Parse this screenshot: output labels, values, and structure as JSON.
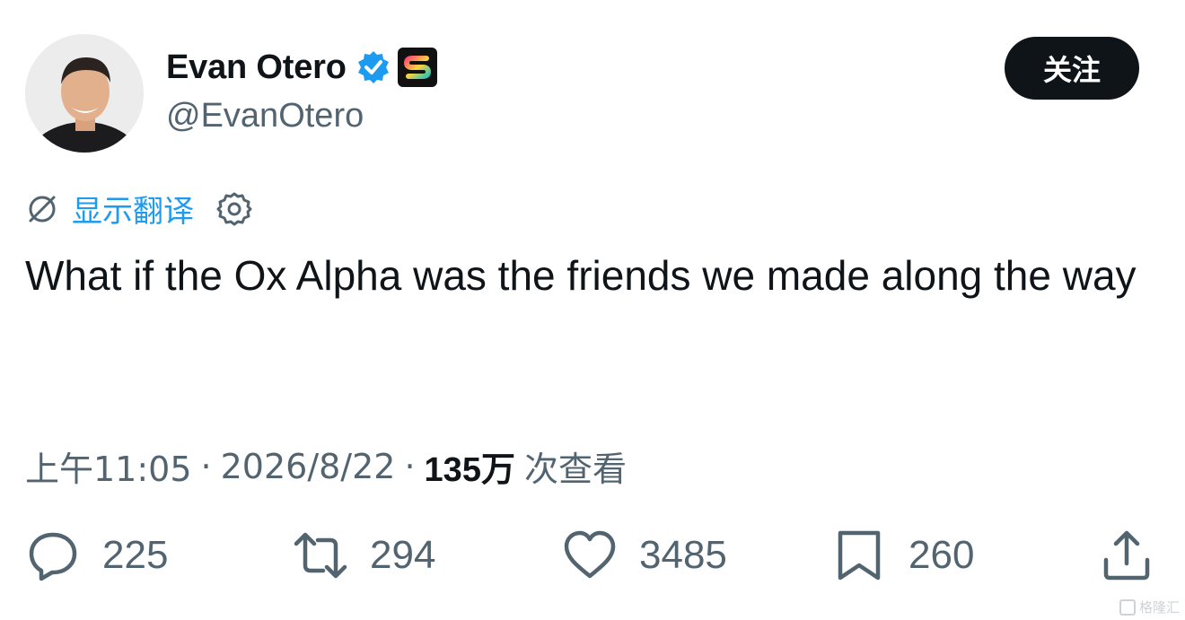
{
  "author": {
    "display_name": "Evan Otero",
    "handle": "@EvanOtero",
    "verified_icon": "verified-badge-icon",
    "affiliation_icon": "affiliate-logo-icon"
  },
  "follow_button": {
    "label": "关注"
  },
  "translate": {
    "label": "显示翻译"
  },
  "tweet": {
    "text": "What if the Ox Alpha was the friends we made along the way"
  },
  "meta": {
    "time": "上午11:05",
    "date": "2026/8/22",
    "separator": "·",
    "views_count": "135万",
    "views_label": "次查看"
  },
  "actions": {
    "reply": {
      "icon": "reply-icon",
      "count": "225"
    },
    "retweet": {
      "icon": "retweet-icon",
      "count": "294"
    },
    "like": {
      "icon": "heart-icon",
      "count": "3485"
    },
    "bookmark": {
      "icon": "bookmark-icon",
      "count": "260"
    },
    "share": {
      "icon": "share-icon"
    }
  },
  "watermark": {
    "text": "格隆汇"
  },
  "colors": {
    "primary_text": "#0f1419",
    "secondary_text": "#536471",
    "link_blue": "#1d9bf0",
    "button_bg": "#0f1419"
  }
}
